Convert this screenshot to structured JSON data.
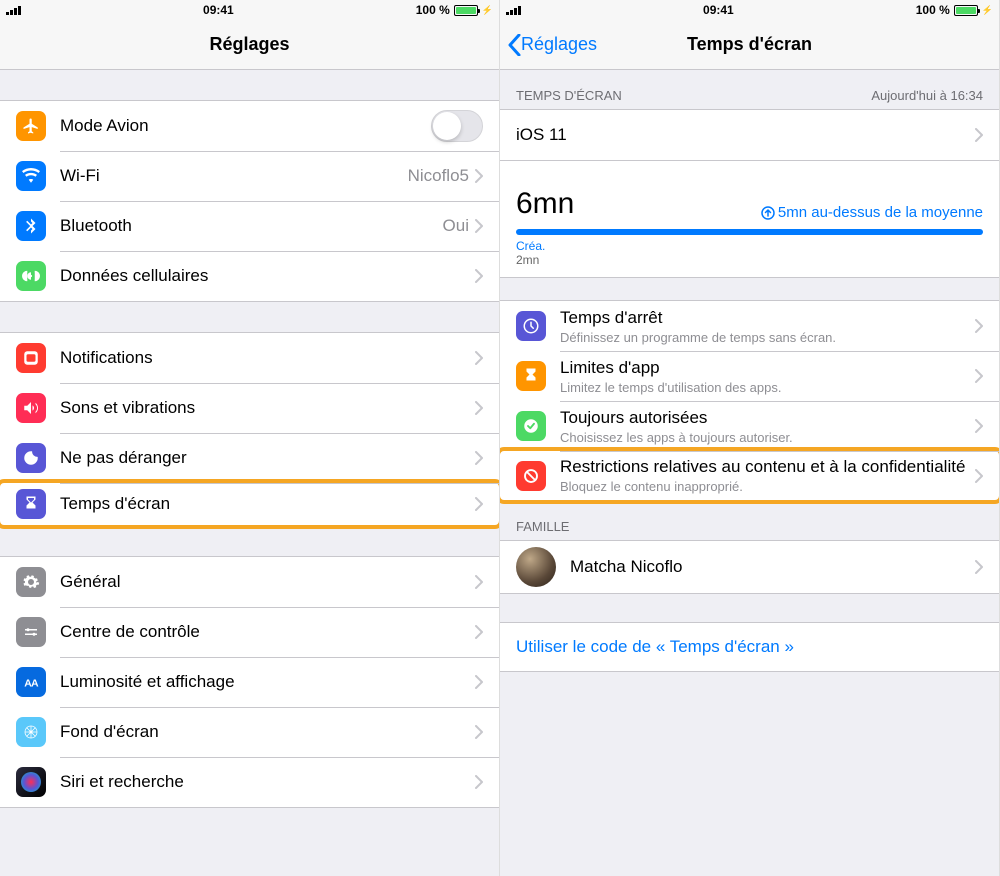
{
  "status": {
    "time": "09:41",
    "batteryText": "100 %"
  },
  "left": {
    "title": "Réglages",
    "group1": [
      {
        "key": "airplane",
        "label": "Mode Avion",
        "iconBg": "bg-orange",
        "toggle": true
      },
      {
        "key": "wifi",
        "label": "Wi-Fi",
        "detail": "Nicoflo5",
        "iconBg": "bg-blue"
      },
      {
        "key": "bluetooth",
        "label": "Bluetooth",
        "detail": "Oui",
        "iconBg": "bg-blue"
      },
      {
        "key": "cellular",
        "label": "Données cellulaires",
        "iconBg": "bg-green"
      }
    ],
    "group2": [
      {
        "key": "notifications",
        "label": "Notifications",
        "iconBg": "bg-notif"
      },
      {
        "key": "sounds",
        "label": "Sons et vibrations",
        "iconBg": "bg-pink"
      },
      {
        "key": "dnd",
        "label": "Ne pas déranger",
        "iconBg": "bg-indigo"
      },
      {
        "key": "screentime",
        "label": "Temps d'écran",
        "iconBg": "bg-indigo",
        "highlight": true
      }
    ],
    "group3": [
      {
        "key": "general",
        "label": "Général",
        "iconBg": "bg-gray"
      },
      {
        "key": "control",
        "label": "Centre de contrôle",
        "iconBg": "bg-gray"
      },
      {
        "key": "display",
        "label": "Luminosité et affichage",
        "iconBg": "bg-darkblue"
      },
      {
        "key": "wallpaper",
        "label": "Fond d'écran",
        "iconBg": "bg-teal"
      },
      {
        "key": "siri",
        "label": "Siri et recherche",
        "iconBg": ""
      }
    ]
  },
  "right": {
    "back": "Réglages",
    "title": "Temps d'écran",
    "sectionHeader": "TEMPS D'ÉCRAN",
    "sectionHeaderRight": "Aujourd'hui à 16:34",
    "device": "iOS 11",
    "big": "6mn",
    "trend": "5mn au-dessus de la moyenne",
    "categoryLabel": "Créa.",
    "categoryValue": "2mn",
    "options": [
      {
        "key": "downtime",
        "title": "Temps d'arrêt",
        "sub": "Définissez un programme de temps sans écran.",
        "iconBg": "bg-indigo"
      },
      {
        "key": "applimits",
        "title": "Limites d'app",
        "sub": "Limitez le temps d'utilisation des apps.",
        "iconBg": "bg-orange"
      },
      {
        "key": "always",
        "title": "Toujours autorisées",
        "sub": "Choisissez les apps à toujours autoriser.",
        "iconBg": "bg-green"
      },
      {
        "key": "restrictions",
        "title": "Restrictions relatives au contenu et à la confidentialité",
        "sub": "Bloquez le contenu inapproprié.",
        "iconBg": "bg-red",
        "highlight": true
      }
    ],
    "familyHeader": "FAMILLE",
    "familyMember": "Matcha Nicoflo",
    "passcodeLink": "Utiliser le code de « Temps d'écran »"
  }
}
